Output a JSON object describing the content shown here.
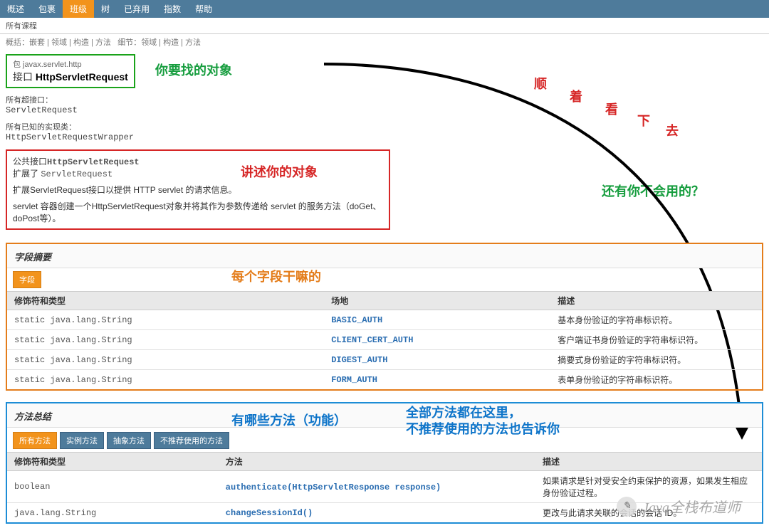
{
  "topnav": [
    "概述",
    "包裹",
    "班级",
    "树",
    "已弃用",
    "指数",
    "帮助"
  ],
  "topnav_active": 2,
  "subnav1": "所有课程",
  "subnav2_left": "概括：嵌套 | 领域 | 构造 | 方法",
  "subnav2_right": "细节：领域 | 构造 | 方法",
  "header": {
    "pkg": "包 javax.servlet.http",
    "label": "接口",
    "name": "HttpServletRequest"
  },
  "annot": {
    "a1": "你要找的对象",
    "a2": [
      "顺",
      "着",
      "看",
      "下",
      "去"
    ],
    "a3": "讲述你的对象",
    "a4": "还有你不会用的？",
    "a5": "每个字段干嘛的",
    "a6": "有哪些方法（功能）",
    "a7_l1": "全部方法都在这里，",
    "a7_l2": "不推荐使用的方法也告诉你"
  },
  "super_if": {
    "lbl": "所有超接口：",
    "val": "ServletRequest"
  },
  "impl": {
    "lbl": "所有已知的实现类：",
    "val": "HttpServletRequestWrapper"
  },
  "desc": {
    "l1a": "公共接口",
    "l1b": "HttpServletRequest",
    "l2a": "扩展了 ",
    "l2b": "ServletRequest",
    "p1": "扩展ServletRequest接口以提供 HTTP servlet 的请求信息。",
    "p2": "servlet 容器创建一个HttpServletRequest对象并将其作为参数传递给 servlet 的服务方法（doGet、doPost等）。"
  },
  "fields": {
    "title": "字段摘要",
    "tab": "字段",
    "cols": [
      "修饰符和类型",
      "场地",
      "描述"
    ],
    "rows": [
      {
        "t": "static java.lang.String",
        "n": "BASIC_AUTH",
        "d": "基本身份验证的字符串标识符。"
      },
      {
        "t": "static java.lang.String",
        "n": "CLIENT_CERT_AUTH",
        "d": "客户端证书身份验证的字符串标识符。"
      },
      {
        "t": "static java.lang.String",
        "n": "DIGEST_AUTH",
        "d": "摘要式身份验证的字符串标识符。"
      },
      {
        "t": "static java.lang.String",
        "n": "FORM_AUTH",
        "d": "表单身份验证的字符串标识符。"
      }
    ]
  },
  "methods": {
    "title": "方法总结",
    "tabs": [
      "所有方法",
      "实例方法",
      "抽象方法",
      "不推荐使用的方法"
    ],
    "cols": [
      "修饰符和类型",
      "方法",
      "描述"
    ],
    "rows": [
      {
        "t": "boolean",
        "n": "authenticate(HttpServletResponse response)",
        "d": "如果请求是针对受安全约束保护的资源，如果发生相应身份验证过程。"
      },
      {
        "t": "java.lang.String",
        "n": "changeSessionId()",
        "d": "更改与此请求关联的会话的会话 ID。"
      }
    ]
  },
  "watermark": "Java全栈布道师"
}
